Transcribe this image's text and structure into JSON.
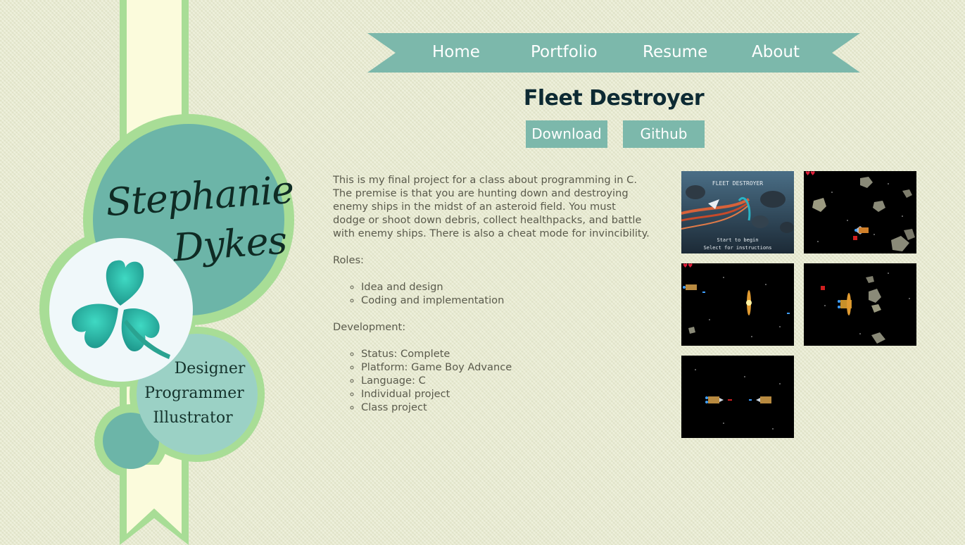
{
  "brand": {
    "first_name": "Stephanie",
    "last_name": "Dykes",
    "roles": [
      "Designer",
      "Programmer",
      "Illustrator"
    ],
    "logo_icon": "clover-icon"
  },
  "nav": {
    "items": [
      {
        "label": "Home"
      },
      {
        "label": "Portfolio"
      },
      {
        "label": "Resume"
      },
      {
        "label": "About"
      }
    ]
  },
  "project": {
    "title": "Fleet Destroyer",
    "buttons": {
      "download": "Download",
      "github": "Github"
    },
    "description": "This is my final project for a class about programming in C. The premise is that you are hunting down and destroying enemy ships in the midst of an asteroid field. You must dodge or shoot down debris, collect healthpacks, and battle with enemy ships. There is also a cheat mode for invincibility.",
    "roles_heading": "Roles:",
    "roles": [
      "Idea and design",
      "Coding and implementation"
    ],
    "development_heading": "Development:",
    "development": [
      "Status: Complete",
      "Platform: Game Boy Advance",
      "Language: C",
      "Individual project",
      "Class project"
    ],
    "screenshots": {
      "title_screen": {
        "title": "FLEET DESTROYER",
        "line1": "Start to begin",
        "line2": "Select for instructions"
      }
    }
  },
  "colors": {
    "background": "#e9ecd0",
    "teal": "#7cb8ab",
    "ribbon_cream": "#fbfbdc",
    "ribbon_green": "#a8dd96",
    "title_navy": "#0d2a33"
  }
}
